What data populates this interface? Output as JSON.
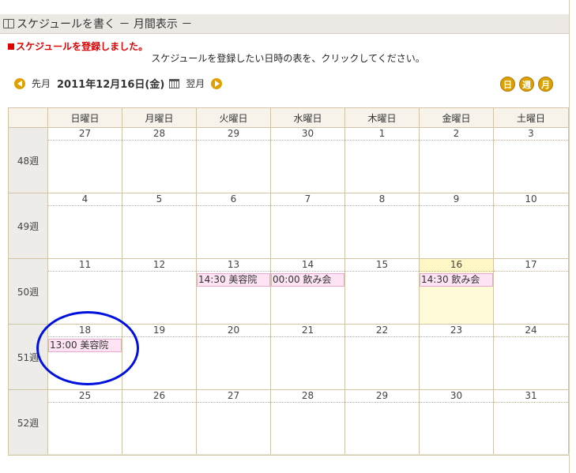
{
  "header": {
    "title": "スケジュールを書く － 月間表示 －"
  },
  "messages": {
    "success": "スケジュールを登録しました。",
    "hint": "スケジュールを登録したい日時の表を、クリックしてください。"
  },
  "nav": {
    "prev_label": "先月",
    "current_date": "2011年12月16日(金)",
    "next_label": "翌月"
  },
  "view_buttons": {
    "day": "日",
    "week": "週",
    "month": "月"
  },
  "calendar": {
    "weekday_headers": [
      "日曜日",
      "月曜日",
      "火曜日",
      "水曜日",
      "木曜日",
      "金曜日",
      "土曜日"
    ],
    "weeks": [
      {
        "label": "48週",
        "days": [
          {
            "day": "27",
            "event": ""
          },
          {
            "day": "28",
            "event": ""
          },
          {
            "day": "29",
            "event": ""
          },
          {
            "day": "30",
            "event": ""
          },
          {
            "day": "1",
            "event": ""
          },
          {
            "day": "2",
            "event": ""
          },
          {
            "day": "3",
            "event": ""
          }
        ]
      },
      {
        "label": "49週",
        "days": [
          {
            "day": "4",
            "event": ""
          },
          {
            "day": "5",
            "event": ""
          },
          {
            "day": "6",
            "event": ""
          },
          {
            "day": "7",
            "event": ""
          },
          {
            "day": "8",
            "event": ""
          },
          {
            "day": "9",
            "event": ""
          },
          {
            "day": "10",
            "event": ""
          }
        ]
      },
      {
        "label": "50週",
        "days": [
          {
            "day": "11",
            "event": ""
          },
          {
            "day": "12",
            "event": ""
          },
          {
            "day": "13",
            "event": "14:30 美容院"
          },
          {
            "day": "14",
            "event": "00:00 飲み会"
          },
          {
            "day": "15",
            "event": ""
          },
          {
            "day": "16",
            "event": "14:30 飲み会",
            "today": true
          },
          {
            "day": "17",
            "event": ""
          }
        ]
      },
      {
        "label": "51週",
        "days": [
          {
            "day": "18",
            "event": "13:00 美容院"
          },
          {
            "day": "19",
            "event": ""
          },
          {
            "day": "20",
            "event": ""
          },
          {
            "day": "21",
            "event": ""
          },
          {
            "day": "22",
            "event": ""
          },
          {
            "day": "23",
            "event": ""
          },
          {
            "day": "24",
            "event": ""
          }
        ]
      },
      {
        "label": "52週",
        "days": [
          {
            "day": "25",
            "event": ""
          },
          {
            "day": "26",
            "event": ""
          },
          {
            "day": "27",
            "event": ""
          },
          {
            "day": "28",
            "event": ""
          },
          {
            "day": "29",
            "event": ""
          },
          {
            "day": "30",
            "event": ""
          },
          {
            "day": "31",
            "event": ""
          }
        ]
      }
    ]
  },
  "colors": {
    "accent": "#e0a000",
    "today_bg": "#fffbd9",
    "event_bg": "#fde3f3",
    "error": "#e00000",
    "annotation": "#0010e0"
  }
}
